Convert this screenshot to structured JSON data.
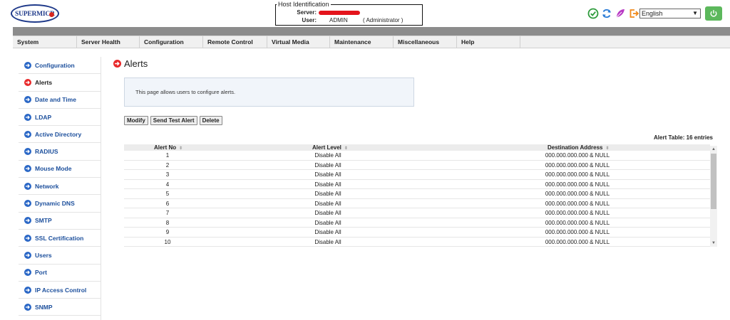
{
  "header": {
    "logo_text": "SUPERMICR",
    "host_id": {
      "legend": "Host Identification",
      "server_label": "Server:",
      "user_label": "User:",
      "user_value": "ADMIN",
      "role": "( Administrator )"
    },
    "language": {
      "selected": "English"
    }
  },
  "menu": [
    "System",
    "Server Health",
    "Configuration",
    "Remote Control",
    "Virtual Media",
    "Maintenance",
    "Miscellaneous",
    "Help"
  ],
  "sidebar": {
    "items": [
      {
        "label": "Configuration"
      },
      {
        "label": "Alerts"
      },
      {
        "label": "Date and Time"
      },
      {
        "label": "LDAP"
      },
      {
        "label": "Active Directory"
      },
      {
        "label": "RADIUS"
      },
      {
        "label": "Mouse Mode"
      },
      {
        "label": "Network"
      },
      {
        "label": "Dynamic DNS"
      },
      {
        "label": "SMTP"
      },
      {
        "label": "SSL Certification"
      },
      {
        "label": "Users"
      },
      {
        "label": "Port"
      },
      {
        "label": "IP Access Control"
      },
      {
        "label": "SNMP"
      }
    ],
    "active_index": 1
  },
  "main": {
    "title": "Alerts",
    "info": "This page allows users to configure alerts.",
    "buttons": {
      "modify": "Modify",
      "send_test": "Send Test Alert",
      "delete": "Delete"
    },
    "table_count": "Alert Table: 16 entries",
    "columns": [
      "Alert No",
      "Alert Level",
      "Destination Address"
    ],
    "rows": [
      [
        "1",
        "Disable All",
        "000.000.000.000 & NULL"
      ],
      [
        "2",
        "Disable All",
        "000.000.000.000 & NULL"
      ],
      [
        "3",
        "Disable All",
        "000.000.000.000 & NULL"
      ],
      [
        "4",
        "Disable All",
        "000.000.000.000 & NULL"
      ],
      [
        "5",
        "Disable All",
        "000.000.000.000 & NULL"
      ],
      [
        "6",
        "Disable All",
        "000.000.000.000 & NULL"
      ],
      [
        "7",
        "Disable All",
        "000.000.000.000 & NULL"
      ],
      [
        "8",
        "Disable All",
        "000.000.000.000 & NULL"
      ],
      [
        "9",
        "Disable All",
        "000.000.000.000 & NULL"
      ],
      [
        "10",
        "Disable All",
        "000.000.000.000 & NULL"
      ]
    ]
  },
  "colors": {
    "accent_red": "#e8292a",
    "link_blue": "#1c4f9c",
    "icon_blue": "#2a67c6",
    "menu_gray": "#8c8c8c",
    "power_green": "#5cb85c"
  },
  "icons": {
    "tools": [
      "check-circle-icon",
      "refresh-icon",
      "feather-icon",
      "logout-icon"
    ],
    "power": "power-icon"
  }
}
